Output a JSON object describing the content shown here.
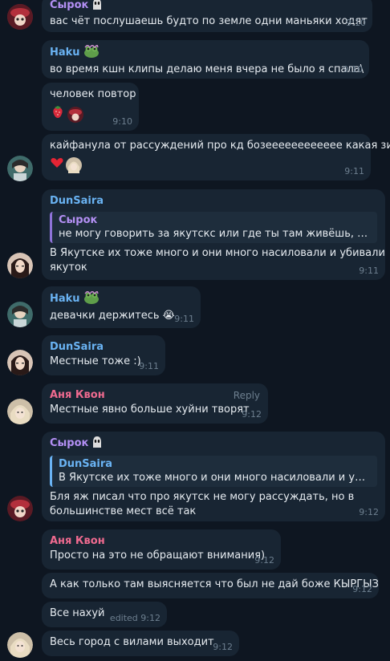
{
  "colors": {
    "background": "#0e1621",
    "bubble": "#182533",
    "sender_syrok": "#b490f5",
    "sender_haku": "#6ab3f3",
    "sender_dunsaira": "#6ab3f3",
    "sender_anya": "#ee6a8f",
    "time": "#6d7f8f"
  },
  "messages": [
    {
      "sender": "Сырок",
      "text": "вас чёт послушаешь будто по земле одни маньяки ходят",
      "time": "9:10"
    },
    {
      "sender": "Haku",
      "text": "во время кшн клипы делаю меня вчера не было я спала\\",
      "time": "9:10"
    },
    {
      "text": "человек повтор",
      "time": "9:10",
      "reactions": [
        "strawberry-icon",
        "avatar-icon"
      ]
    },
    {
      "text": "кайфанула от рассуждений про кд бозееееееееееее какая зизя",
      "time": "9:11",
      "reactions": [
        "heart-icon",
        "avatar-icon"
      ]
    },
    {
      "sender": "DunSaira",
      "quote": {
        "sender": "Сырок",
        "text": "не могу говорить за якутскс или где ты там живёшь, но в по..."
      },
      "text_lines": [
        "В Якутске их тоже много и они много насиловали и убивали",
        "якуток"
      ],
      "time": "9:11"
    },
    {
      "sender": "Haku",
      "text": "девачки держитесь",
      "emoji": "😭",
      "time": "9:11"
    },
    {
      "sender": "DunSaira",
      "text": "Местные тоже :)",
      "time": "9:11"
    },
    {
      "sender": "Аня Квон",
      "reply_label": "Reply",
      "text": "Местные явно больше хуйни творят",
      "time": "9:12"
    },
    {
      "sender": "Сырок",
      "quote": {
        "sender": "DunSaira",
        "text": "В Якутске их тоже много и они много насиловали и убивали ..."
      },
      "text_lines": [
        "Бля яж писал что про якутск не могу рассуждать, но в",
        "большинстве мест всё так"
      ],
      "time": "9:12"
    },
    {
      "sender": "Аня Квон",
      "text": "Просто на это не обращают внимания)",
      "time": "9:12"
    },
    {
      "text": "А как только там выясняется что был не дай боже КЫРГЫЗ",
      "time": "9:12"
    },
    {
      "text": "Все нахуй",
      "edited": "edited",
      "time": "9:12"
    },
    {
      "text": "Весь город с вилами выходит",
      "time": "9:12"
    }
  ]
}
